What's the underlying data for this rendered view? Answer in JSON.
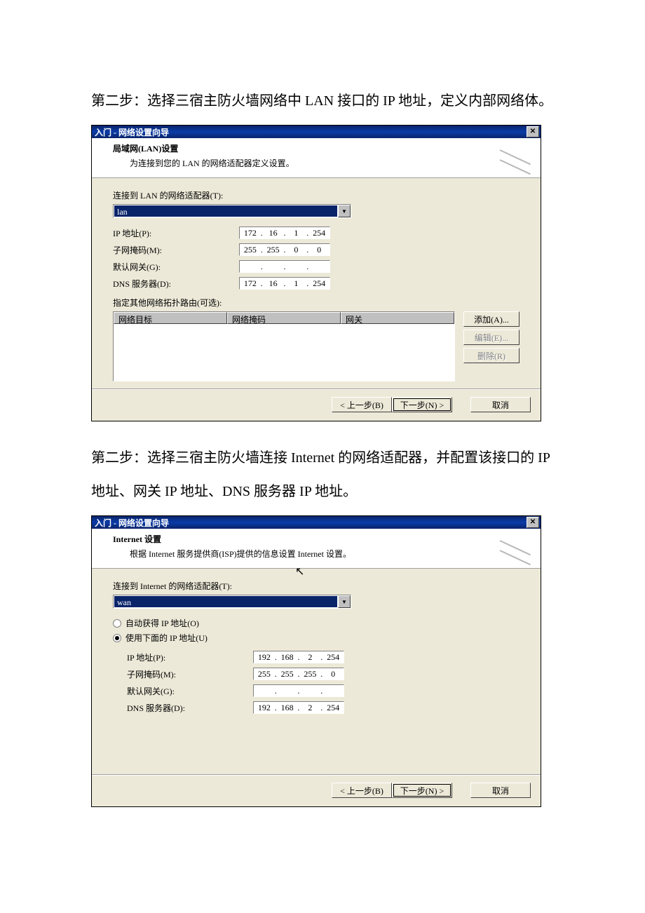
{
  "caption1": "第二步：选择三宿主防火墙网络中 LAN 接口的 IP 地址，定义内部网络体。",
  "caption2": "第二步：选择三宿主防火墙连接 Internet 的网络适配器，并配置该接口的 IP 地址、网关 IP 地址、DNS 服务器 IP 地址。",
  "dialog1": {
    "title": "入门 - 网络设置向导",
    "header_title": "局域网(LAN)设置",
    "header_sub": "为连接到您的 LAN 的网络适配器定义设置。",
    "adapter_label": "连接到 LAN 的网络适配器(T):",
    "adapter_value": "lan",
    "ip_label": "IP 地址(P):",
    "ip": [
      "172",
      "16",
      "1",
      "254"
    ],
    "mask_label": "子网掩码(M):",
    "mask": [
      "255",
      "255",
      "0",
      "0"
    ],
    "gw_label": "默认网关(G):",
    "gw": [
      "",
      "",
      "",
      ""
    ],
    "dns_label": "DNS 服务器(D):",
    "dns": [
      "172",
      "16",
      "1",
      "254"
    ],
    "routes_label": "指定其他网络拓扑路由(可选):",
    "col_dest": "网络目标",
    "col_mask": "网络掩码",
    "col_gw": "网关",
    "btn_add": "添加(A)...",
    "btn_edit": "编辑(E)...",
    "btn_del": "删除(R)",
    "btn_back": "< 上一步(B)",
    "btn_next": "下一步(N) >",
    "btn_cancel": "取消"
  },
  "dialog2": {
    "title": "入门 - 网络设置向导",
    "header_title": "Internet 设置",
    "header_sub": "根据 Internet 服务提供商(ISP)提供的信息设置 Internet 设置。",
    "adapter_label": "连接到 Internet 的网络适配器(T):",
    "adapter_value": "wan",
    "radio_auto": "自动获得 IP 地址(O)",
    "radio_manual": "使用下面的 IP 地址(U)",
    "ip_label": "IP 地址(P):",
    "ip": [
      "192",
      "168",
      "2",
      "254"
    ],
    "mask_label": "子网掩码(M):",
    "mask": [
      "255",
      "255",
      "255",
      "0"
    ],
    "gw_label": "默认网关(G):",
    "gw": [
      "",
      "",
      "",
      ""
    ],
    "dns_label": "DNS 服务器(D):",
    "dns": [
      "192",
      "168",
      "2",
      "254"
    ],
    "btn_back": "< 上一步(B)",
    "btn_next": "下一步(N) >",
    "btn_cancel": "取消"
  }
}
